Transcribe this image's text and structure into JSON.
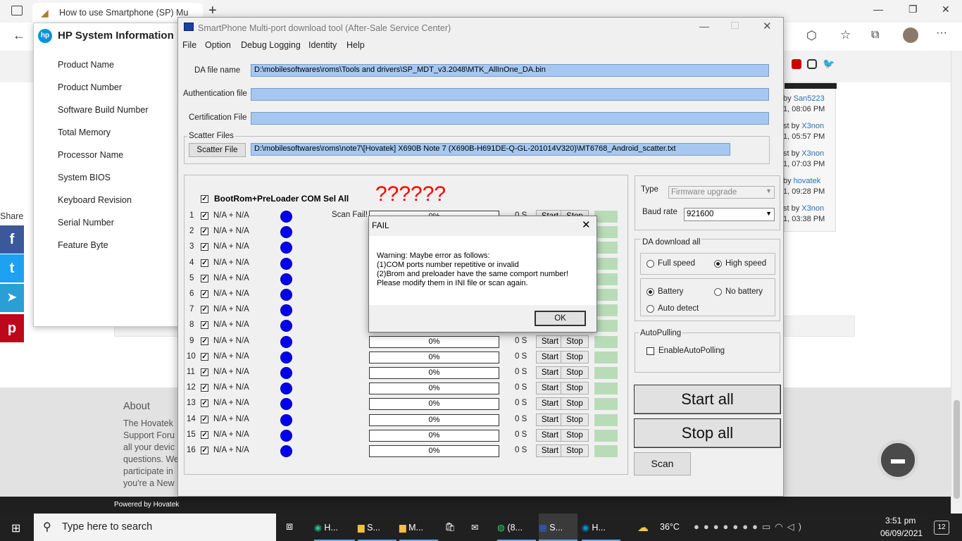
{
  "browser": {
    "tab_title": "How to use Smartphone (SP) Mu",
    "new_tab": "+",
    "window_min": "—",
    "window_max": "❐",
    "window_close": "✕",
    "more": "···"
  },
  "page": {
    "share_label": "Share",
    "posts": [
      {
        "by": "by",
        "user": "San5223",
        "time": "1, 08:06 PM"
      },
      {
        "by": "st by",
        "user": "X3non",
        "time": "1, 05:57 PM"
      },
      {
        "by": "st by",
        "user": "X3non",
        "time": "1, 07:03 PM"
      },
      {
        "by": "by",
        "user": "hovatek",
        "time": "1, 09:28 PM"
      },
      {
        "by": "st by",
        "user": "X3non",
        "time": "1, 03:38 PM"
      }
    ],
    "about_title": "About",
    "about_lines": [
      "The Hovatek",
      "Support Foru",
      "all your devic",
      "questions. We",
      "participate in",
      "you're a New"
    ],
    "powered": "Powered by Hovatek"
  },
  "hp": {
    "title": "HP System Information",
    "items": [
      "Product Name",
      "Product Number",
      "Software Build Number",
      "Total Memory",
      "Processor Name",
      "System BIOS",
      "Keyboard Revision",
      "Serial Number",
      "Feature Byte"
    ]
  },
  "tool": {
    "title": "SmartPhone Multi-port download tool (After-Sale Service Center)",
    "menu": [
      "File",
      "Option",
      "Debug Logging",
      "Identity",
      "Help"
    ],
    "da_label": "DA file name",
    "da_value": "D:\\mobilesoftwares\\roms\\Tools and drivers\\SP_MDT_v3.2048\\MTK_AllInOne_DA.bin",
    "auth_label": "Authentication file",
    "auth_value": "",
    "cert_label": "Certification File",
    "cert_value": "",
    "scatter_group": "Scatter Files",
    "scatter_btn": "Scatter File",
    "scatter_value": "D:\\mobilesoftwares\\roms\\note7\\[Hovatek] X690B Note 7 (X690B-H691DE-Q-GL-201014V320)\\MT6768_Android_scatter.txt",
    "selall": "BootRom+PreLoader COM Sel All",
    "annotation": "??????",
    "scan_fail": "Scan Fail!",
    "port_text": "N/A + N/A",
    "progress": "0%",
    "time": "0 S",
    "start": "Start",
    "stop": "Stop",
    "check": "✓",
    "ports": [
      "1",
      "2",
      "3",
      "4",
      "5",
      "6",
      "7",
      "8",
      "9",
      "10",
      "11",
      "12",
      "13",
      "14",
      "15",
      "16"
    ],
    "type_label": "Type",
    "type_value": "Firmware upgrade",
    "baud_label": "Baud rate",
    "baud_value": "921600",
    "da_all_group": "DA download all",
    "full_speed": "Full speed",
    "high_speed": "High speed",
    "battery": "Battery",
    "no_battery": "No battery",
    "auto_detect": "Auto detect",
    "autopull_group": "AutoPulling",
    "autopull_cb": "EnableAutoPolling",
    "start_all": "Start all",
    "stop_all": "Stop all",
    "scan": "Scan"
  },
  "fail": {
    "title": "FAIL",
    "lines": [
      "Warning: Maybe error as follows:",
      "(1)COM ports number repetitive or invalid",
      "(2)Brom and preloader have the same comport number!",
      "Please modify them in INI file or scan again."
    ],
    "ok": "OK"
  },
  "taskbar": {
    "search": "Type here to search",
    "apps": [
      "H...",
      "S...",
      "M...",
      "(8...",
      "S...",
      "H..."
    ],
    "temp": "36°C",
    "time": "3:51 pm",
    "date": "06/09/2021",
    "notif": "12"
  },
  "colors": {
    "field": "#a6c8f0",
    "annotation": "#ff0000",
    "dot": "#0000ee"
  }
}
